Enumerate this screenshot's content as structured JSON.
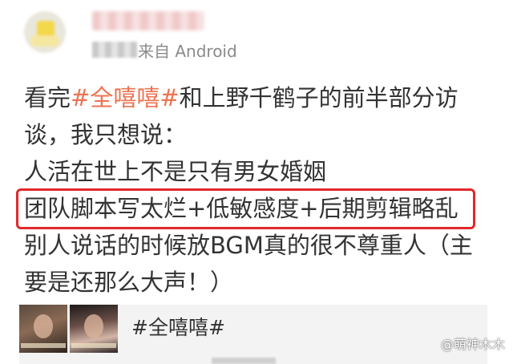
{
  "post": {
    "source_text": "来自 Android",
    "lines": [
      {
        "parts": [
          {
            "text": "看完",
            "tag": false
          },
          {
            "text": "#全嘻嘻#",
            "tag": true
          },
          {
            "text": "和上野千鹤子的前半部分访",
            "tag": false
          }
        ]
      },
      {
        "parts": [
          {
            "text": "谈，我只想说：",
            "tag": false
          }
        ]
      },
      {
        "parts": [
          {
            "text": "人活在世上不是只有男女婚姻",
            "tag": false
          }
        ]
      },
      {
        "parts": [
          {
            "text": "团队脚本写太烂+低敏感度+后期剪辑略乱",
            "tag": false
          }
        ]
      },
      {
        "parts": [
          {
            "text": "别人说话的时候放BGM真的很不尊重人（主",
            "tag": false
          }
        ]
      },
      {
        "parts": [
          {
            "text": "要是还那么大声！）",
            "tag": false
          }
        ]
      }
    ]
  },
  "card": {
    "title": "#全嘻嘻#"
  },
  "watermark": "@萌神木木",
  "colors": {
    "hashtag": "#eb7350",
    "highlight_border": "#e0292b",
    "text": "#333333",
    "source": "#8a8a8a"
  }
}
